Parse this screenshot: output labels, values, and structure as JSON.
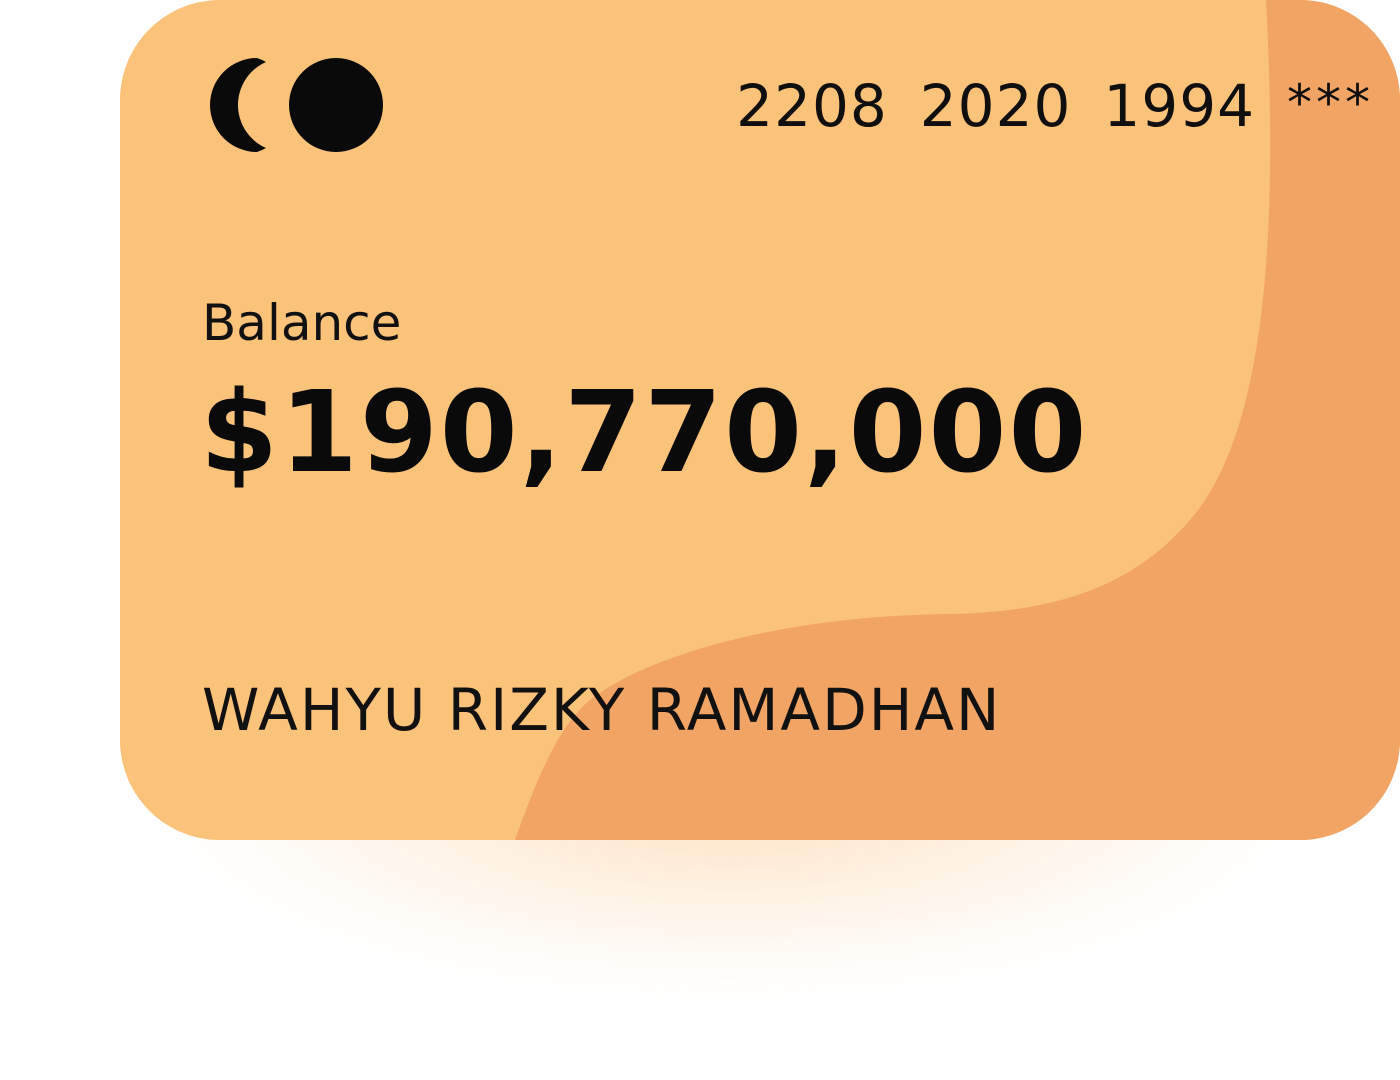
{
  "card": {
    "brand_icon": "dual-circle-card-logo-icon",
    "number_groups": [
      "2208",
      "2020",
      "1994"
    ],
    "number_masked": "***",
    "balance_label": "Balance",
    "balance_amount": "$190,770,000",
    "cardholder_name": "WAHYU RIZKY RAMADHAN"
  },
  "colors": {
    "card_base": "#fbc27a",
    "card_wave": "#f1a464",
    "shadow": "#fde0bd",
    "text": "#0f0f0f"
  }
}
